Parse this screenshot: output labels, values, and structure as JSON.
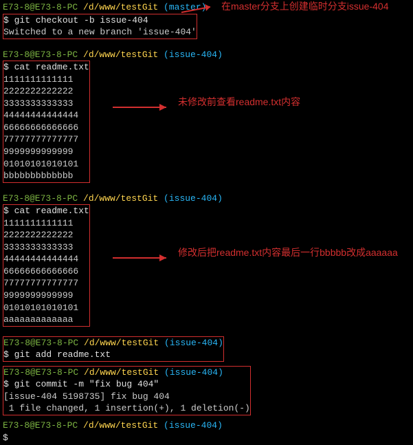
{
  "prompt1": {
    "host": "E73-8@E73-8-PC",
    "path": " /d/www/testGit",
    "branch": " (master)"
  },
  "cmd1": "$ git checkout -b issue-404",
  "out1": "Switched to a new branch 'issue-404'",
  "annot1": "在master分支上创建临时分支issue-404",
  "prompt2": {
    "host": "E73-8@E73-8-PC",
    "path": " /d/www/testGit",
    "branch": " (issue-404)"
  },
  "cmd2": "$ cat readme.txt",
  "file_before": [
    "1111111111111",
    "2222222222222",
    "3333333333333",
    "44444444444444",
    "66666666666666",
    "77777777777777",
    "9999999999999",
    "01010101010101",
    "bbbbbbbbbbbbb"
  ],
  "annot2": "未修改前查看readme.txt内容",
  "prompt3": {
    "host": "E73-8@E73-8-PC",
    "path": " /d/www/testGit",
    "branch": " (issue-404)"
  },
  "cmd3": "$ cat readme.txt",
  "file_after": [
    "1111111111111",
    "2222222222222",
    "3333333333333",
    "44444444444444",
    "66666666666666",
    "77777777777777",
    "9999999999999",
    "01010101010101",
    "aaaaaaaaaaaaa"
  ],
  "annot3": "修改后把readme.txt内容最后一行bbbbb改成aaaaaa",
  "prompt4": {
    "host": "E73-8@E73-8-PC",
    "path": " /d/www/testGit",
    "branch": " (issue-404)"
  },
  "cmd4": "$ git add readme.txt",
  "prompt5": {
    "host": "E73-8@E73-8-PC",
    "path": " /d/www/testGit",
    "branch": " (issue-404)"
  },
  "cmd5": "$ git commit -m \"fix bug 404\"",
  "commit_out": [
    "[issue-404 5198735] fix bug 404",
    " 1 file changed, 1 insertion(+), 1 deletion(-)"
  ],
  "prompt6": {
    "host": "E73-8@E73-8-PC",
    "path": " /d/www/testGit",
    "branch": " (issue-404)"
  },
  "cmd6": "$"
}
